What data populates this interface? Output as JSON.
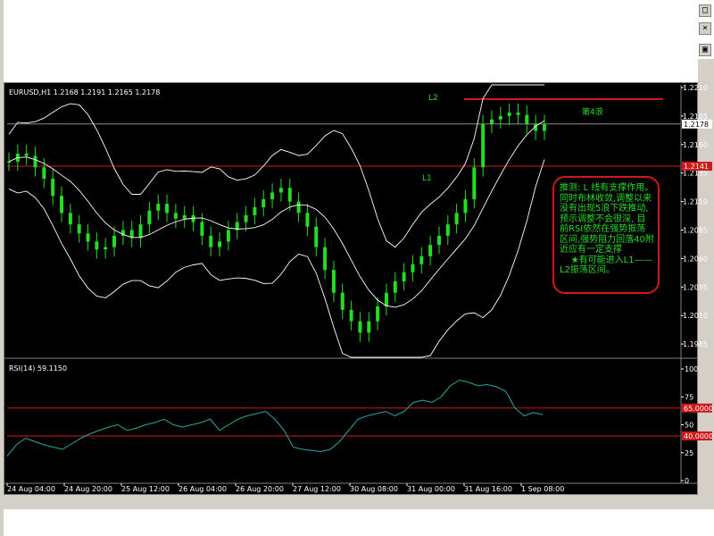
{
  "window": {
    "buttons": [
      "□",
      "×",
      "▣"
    ]
  },
  "main_chart": {
    "header": "EURUSD,H1  1.2168 1.2191 1.2165 1.2178",
    "price_labels": [
      "1.2210",
      "1.2185",
      "1.2160",
      "1.2135",
      "1.2110",
      "1.2085",
      "1.2060",
      "1.2035",
      "1.2010",
      "1.1985"
    ],
    "current_price": "1.2178",
    "red_line_price": "1.2141",
    "annotations": {
      "l2": "L2",
      "l1": "L1",
      "wave4": "第4浪"
    },
    "note_text": "推测: L 线有支撑作用。同时布林收敛,调整以来没有出现5浪下跌推动, 预示调整不会很深, 目前RSI依然在强势振荡区间,强势阻力回落40附近应有一定支撑\n    ★有可能进入L1——L2振荡区间。"
  },
  "rsi_panel": {
    "header": "RSI(14)  59.1150",
    "labels": [
      "100",
      "75",
      "50",
      "25",
      "0"
    ],
    "level_high": "65.0000",
    "level_low": "40.0000"
  },
  "time_axis": [
    "24 Aug 04:00",
    "24 Aug 20:00",
    "25 Aug 12:00",
    "26 Aug 04:00",
    "26 Aug 20:00",
    "27 Aug 12:00",
    "30 Aug 08:00",
    "31 Aug 00:00",
    "31 Aug 16:00",
    "1 Sep 08:00"
  ],
  "colors": {
    "background": "#000000",
    "candle": "#22dd22",
    "bollinger": "#ffffff",
    "red_line": "#d01818",
    "rsi_line": "#2aa6a6",
    "note_text": "#22dd22"
  },
  "chart_data": {
    "type": "line",
    "series": [
      {
        "name": "EURUSD",
        "close": [
          1.2145,
          1.2152,
          1.215,
          1.214,
          1.213,
          1.2115,
          1.21,
          1.209,
          1.2082,
          1.2075,
          1.2068,
          1.207,
          1.208,
          1.2085,
          1.2078,
          1.209,
          1.2102,
          1.2108,
          1.21,
          1.2095,
          1.2098,
          1.2092,
          1.208,
          1.207,
          1.2075,
          1.2085,
          1.2092,
          1.2098,
          1.2105,
          1.2112,
          1.2118,
          1.2122,
          1.211,
          1.21,
          1.2088,
          1.207,
          1.205,
          1.203,
          1.2015,
          1.2005,
          1.1995,
          1.2005,
          1.2018,
          1.203,
          1.204,
          1.2048,
          1.2055,
          1.2062,
          1.2072,
          1.208,
          1.209,
          1.21,
          1.2112,
          1.214,
          1.2178,
          1.2182,
          1.2185,
          1.2188,
          1.2186,
          1.2178,
          1.2172,
          1.2178
        ]
      },
      {
        "name": "RSI(14)",
        "values": [
          22,
          32,
          38,
          35,
          32,
          30,
          28,
          33,
          38,
          42,
          45,
          48,
          50,
          45,
          47,
          50,
          52,
          55,
          50,
          48,
          50,
          52,
          55,
          45,
          50,
          55,
          58,
          60,
          62,
          55,
          45,
          30,
          28,
          27,
          26,
          28,
          35,
          45,
          55,
          58,
          60,
          62,
          58,
          62,
          70,
          72,
          70,
          75,
          85,
          90,
          88,
          85,
          86,
          84,
          80,
          65,
          58,
          61,
          59
        ]
      }
    ],
    "ylabel": "",
    "ylim": [
      1.1985,
      1.221
    ]
  }
}
